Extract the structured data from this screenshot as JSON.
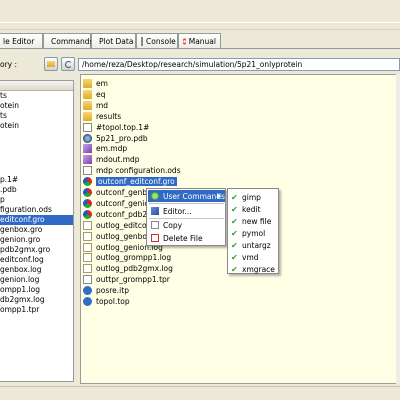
{
  "tabs": [
    {
      "label": "le Editor",
      "icon": "editor-icon"
    },
    {
      "label": "Commands",
      "icon": "commands-icon"
    },
    {
      "label": "Plot Data",
      "icon": "plot-icon"
    },
    {
      "label": "Console",
      "icon": "console-icon"
    },
    {
      "label": "Manual",
      "icon": "manual-icon"
    }
  ],
  "path": {
    "label": "ory :",
    "value": "/home/reza/Desktop/research/simulation/5p21_onlyprotein"
  },
  "left_list": [
    {
      "text": "ts"
    },
    {
      "text": "otein"
    },
    {
      "text": "ts"
    },
    {
      "text": "otein"
    },
    {
      "text": "p.1#"
    },
    {
      "text": ".pdb"
    },
    {
      "text": "p"
    },
    {
      "text": "figuration.ods"
    },
    {
      "text": "editconf.gro",
      "selected": true
    },
    {
      "text": "genbox.gro"
    },
    {
      "text": "genion.gro"
    },
    {
      "text": "pdb2gmx.gro"
    },
    {
      "text": "editconf.log"
    },
    {
      "text": "genbox.log"
    },
    {
      "text": "genion.log"
    },
    {
      "text": "ompp1.log"
    },
    {
      "text": "db2gmx.log"
    },
    {
      "text": "ompp1.tpr"
    }
  ],
  "files": [
    {
      "name": "em",
      "type": "folder"
    },
    {
      "name": "eq",
      "type": "folder"
    },
    {
      "name": "md",
      "type": "folder"
    },
    {
      "name": "results",
      "type": "folder"
    },
    {
      "name": "#topol.top.1#",
      "type": "doc"
    },
    {
      "name": "5p21_pro.pdb",
      "type": "pdb"
    },
    {
      "name": "em.mdp",
      "type": "mdp"
    },
    {
      "name": "mdout.mdp",
      "type": "mdp"
    },
    {
      "name": "mdp configuration.ods",
      "type": "ods"
    },
    {
      "name": "outconf_editconf.gro",
      "type": "gro",
      "selected": true
    },
    {
      "name": "outconf_genbox",
      "type": "gro"
    },
    {
      "name": "outconf_genion",
      "type": "gro"
    },
    {
      "name": "outconf_pdb2gm",
      "type": "gro"
    },
    {
      "name": "outlog_editconf",
      "type": "logi"
    },
    {
      "name": "outlog_genbox.log",
      "type": "logi"
    },
    {
      "name": "outlog_genion.log",
      "type": "logi"
    },
    {
      "name": "outlog_grompp1.log",
      "type": "logi"
    },
    {
      "name": "outlog_pdb2gmx.log",
      "type": "logi"
    },
    {
      "name": "outtpr_grompp1.tpr",
      "type": "tpr"
    },
    {
      "name": "posre.itp",
      "type": "itp"
    },
    {
      "name": "topol.top",
      "type": "itp"
    }
  ],
  "context_menu": {
    "items": [
      {
        "label": "User Commands",
        "icon": "user-commands-icon",
        "highlighted": true
      },
      {
        "label": "Editor...",
        "icon": "editor-icon"
      },
      {
        "label": "Copy",
        "icon": "copy-icon"
      },
      {
        "label": "Delete File",
        "icon": "delete-icon"
      }
    ]
  },
  "submenu": {
    "items": [
      {
        "label": "gimp"
      },
      {
        "label": "kedit"
      },
      {
        "label": "new file"
      },
      {
        "label": "pymol"
      },
      {
        "label": "untargz"
      },
      {
        "label": "vmd"
      },
      {
        "label": "xmgrace"
      }
    ]
  },
  "colors": {
    "selection": "#3169c6",
    "file_panel_bg": "#ffffe6",
    "check": "#2e9e2e"
  }
}
